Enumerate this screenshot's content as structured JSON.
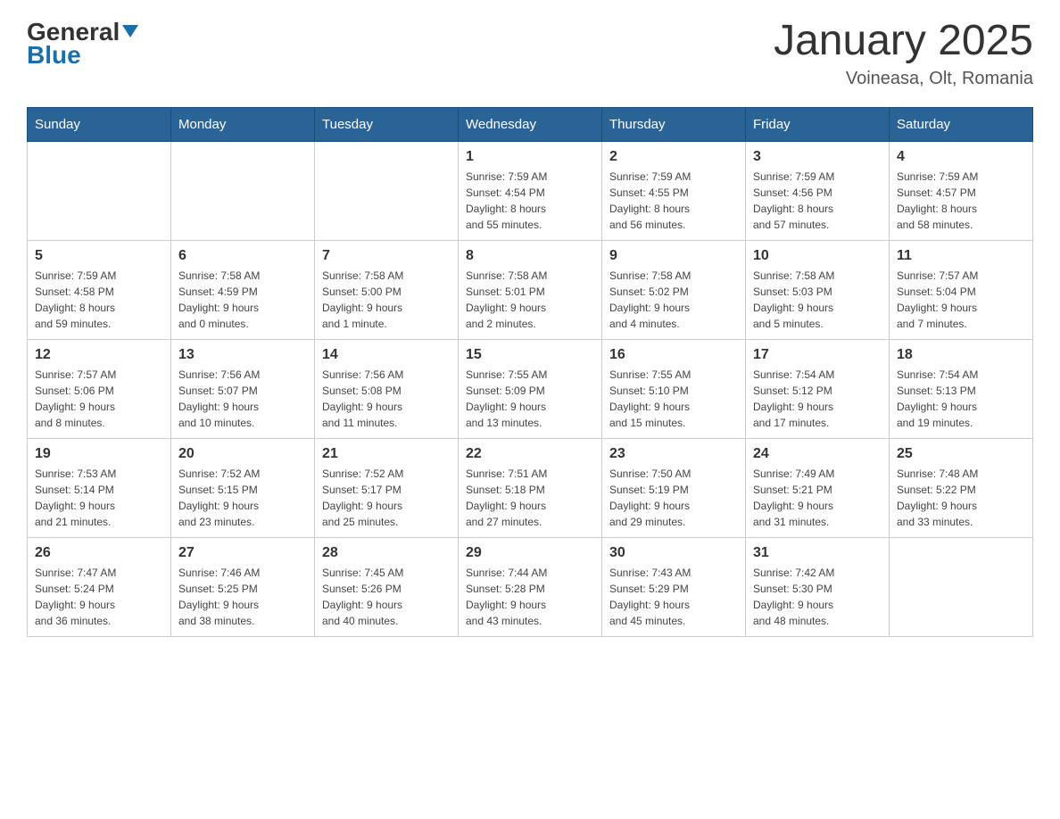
{
  "header": {
    "logo_general": "General",
    "logo_blue": "Blue",
    "title": "January 2025",
    "subtitle": "Voineasa, Olt, Romania"
  },
  "weekdays": [
    "Sunday",
    "Monday",
    "Tuesday",
    "Wednesday",
    "Thursday",
    "Friday",
    "Saturday"
  ],
  "weeks": [
    [
      {
        "day": "",
        "info": ""
      },
      {
        "day": "",
        "info": ""
      },
      {
        "day": "",
        "info": ""
      },
      {
        "day": "1",
        "info": "Sunrise: 7:59 AM\nSunset: 4:54 PM\nDaylight: 8 hours\nand 55 minutes."
      },
      {
        "day": "2",
        "info": "Sunrise: 7:59 AM\nSunset: 4:55 PM\nDaylight: 8 hours\nand 56 minutes."
      },
      {
        "day": "3",
        "info": "Sunrise: 7:59 AM\nSunset: 4:56 PM\nDaylight: 8 hours\nand 57 minutes."
      },
      {
        "day": "4",
        "info": "Sunrise: 7:59 AM\nSunset: 4:57 PM\nDaylight: 8 hours\nand 58 minutes."
      }
    ],
    [
      {
        "day": "5",
        "info": "Sunrise: 7:59 AM\nSunset: 4:58 PM\nDaylight: 8 hours\nand 59 minutes."
      },
      {
        "day": "6",
        "info": "Sunrise: 7:58 AM\nSunset: 4:59 PM\nDaylight: 9 hours\nand 0 minutes."
      },
      {
        "day": "7",
        "info": "Sunrise: 7:58 AM\nSunset: 5:00 PM\nDaylight: 9 hours\nand 1 minute."
      },
      {
        "day": "8",
        "info": "Sunrise: 7:58 AM\nSunset: 5:01 PM\nDaylight: 9 hours\nand 2 minutes."
      },
      {
        "day": "9",
        "info": "Sunrise: 7:58 AM\nSunset: 5:02 PM\nDaylight: 9 hours\nand 4 minutes."
      },
      {
        "day": "10",
        "info": "Sunrise: 7:58 AM\nSunset: 5:03 PM\nDaylight: 9 hours\nand 5 minutes."
      },
      {
        "day": "11",
        "info": "Sunrise: 7:57 AM\nSunset: 5:04 PM\nDaylight: 9 hours\nand 7 minutes."
      }
    ],
    [
      {
        "day": "12",
        "info": "Sunrise: 7:57 AM\nSunset: 5:06 PM\nDaylight: 9 hours\nand 8 minutes."
      },
      {
        "day": "13",
        "info": "Sunrise: 7:56 AM\nSunset: 5:07 PM\nDaylight: 9 hours\nand 10 minutes."
      },
      {
        "day": "14",
        "info": "Sunrise: 7:56 AM\nSunset: 5:08 PM\nDaylight: 9 hours\nand 11 minutes."
      },
      {
        "day": "15",
        "info": "Sunrise: 7:55 AM\nSunset: 5:09 PM\nDaylight: 9 hours\nand 13 minutes."
      },
      {
        "day": "16",
        "info": "Sunrise: 7:55 AM\nSunset: 5:10 PM\nDaylight: 9 hours\nand 15 minutes."
      },
      {
        "day": "17",
        "info": "Sunrise: 7:54 AM\nSunset: 5:12 PM\nDaylight: 9 hours\nand 17 minutes."
      },
      {
        "day": "18",
        "info": "Sunrise: 7:54 AM\nSunset: 5:13 PM\nDaylight: 9 hours\nand 19 minutes."
      }
    ],
    [
      {
        "day": "19",
        "info": "Sunrise: 7:53 AM\nSunset: 5:14 PM\nDaylight: 9 hours\nand 21 minutes."
      },
      {
        "day": "20",
        "info": "Sunrise: 7:52 AM\nSunset: 5:15 PM\nDaylight: 9 hours\nand 23 minutes."
      },
      {
        "day": "21",
        "info": "Sunrise: 7:52 AM\nSunset: 5:17 PM\nDaylight: 9 hours\nand 25 minutes."
      },
      {
        "day": "22",
        "info": "Sunrise: 7:51 AM\nSunset: 5:18 PM\nDaylight: 9 hours\nand 27 minutes."
      },
      {
        "day": "23",
        "info": "Sunrise: 7:50 AM\nSunset: 5:19 PM\nDaylight: 9 hours\nand 29 minutes."
      },
      {
        "day": "24",
        "info": "Sunrise: 7:49 AM\nSunset: 5:21 PM\nDaylight: 9 hours\nand 31 minutes."
      },
      {
        "day": "25",
        "info": "Sunrise: 7:48 AM\nSunset: 5:22 PM\nDaylight: 9 hours\nand 33 minutes."
      }
    ],
    [
      {
        "day": "26",
        "info": "Sunrise: 7:47 AM\nSunset: 5:24 PM\nDaylight: 9 hours\nand 36 minutes."
      },
      {
        "day": "27",
        "info": "Sunrise: 7:46 AM\nSunset: 5:25 PM\nDaylight: 9 hours\nand 38 minutes."
      },
      {
        "day": "28",
        "info": "Sunrise: 7:45 AM\nSunset: 5:26 PM\nDaylight: 9 hours\nand 40 minutes."
      },
      {
        "day": "29",
        "info": "Sunrise: 7:44 AM\nSunset: 5:28 PM\nDaylight: 9 hours\nand 43 minutes."
      },
      {
        "day": "30",
        "info": "Sunrise: 7:43 AM\nSunset: 5:29 PM\nDaylight: 9 hours\nand 45 minutes."
      },
      {
        "day": "31",
        "info": "Sunrise: 7:42 AM\nSunset: 5:30 PM\nDaylight: 9 hours\nand 48 minutes."
      },
      {
        "day": "",
        "info": ""
      }
    ]
  ]
}
